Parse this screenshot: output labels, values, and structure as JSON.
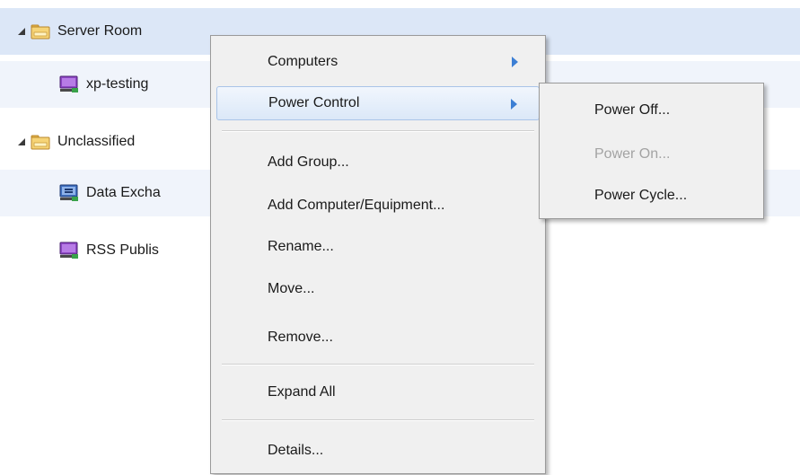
{
  "tree": {
    "rows": [
      {
        "label": "Server Room",
        "type": "group"
      },
      {
        "label": "xp-testing",
        "type": "computer"
      },
      {
        "label": "Unclassified",
        "type": "group"
      },
      {
        "label": "Data Excha",
        "type": "computer"
      },
      {
        "label": "RSS Publis",
        "type": "computer"
      }
    ]
  },
  "context_menu": {
    "computers": "Computers",
    "power_control": "Power Control",
    "add_group": "Add Group...",
    "add_computer": "Add Computer/Equipment...",
    "rename": "Rename...",
    "move": "Move...",
    "remove": "Remove...",
    "expand_all": "Expand All",
    "details": "Details..."
  },
  "power_submenu": {
    "power_off": "Power Off...",
    "power_on": "Power On...",
    "power_cycle": "Power Cycle..."
  },
  "colors": {
    "selected_row": "#dce7f7",
    "alternate_row": "#f0f4fb",
    "menu_background": "#f0f0f0",
    "submenu_arrow": "#3c7fd4",
    "disabled_text": "#a3a3a3"
  }
}
